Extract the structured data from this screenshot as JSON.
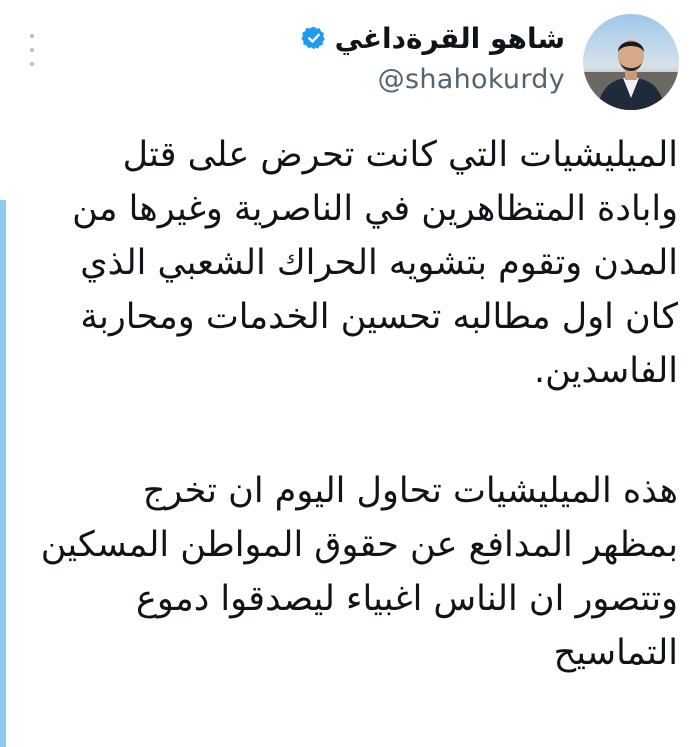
{
  "tweet": {
    "author": {
      "display_name": "شاهو القرةداغي",
      "handle": "@shahokurdy",
      "verified": true,
      "verified_color": "#1d9bf0"
    },
    "more_icon": "more-vertical-icon",
    "text_lines_p1": [
      "الميليشيات التي كانت تحرض على قتل",
      "وابادة المتظاهرين في الناصرية وغيرها من",
      "المدن وتقوم بتشويه الحراك الشعبي الذي",
      "كان اول مطالبه تحسين الخدمات ومحاربة",
      "الفاسدين."
    ],
    "text_lines_p2": [
      "هذه الميليشيات تحاول اليوم ان تخرج",
      "بمظهر المدافع عن حقوق المواطن المسكين",
      "وتتصور ان الناس اغبياء ليصدقوا دموع",
      "التماسيح"
    ],
    "accent_color": "#8fc9ee"
  }
}
